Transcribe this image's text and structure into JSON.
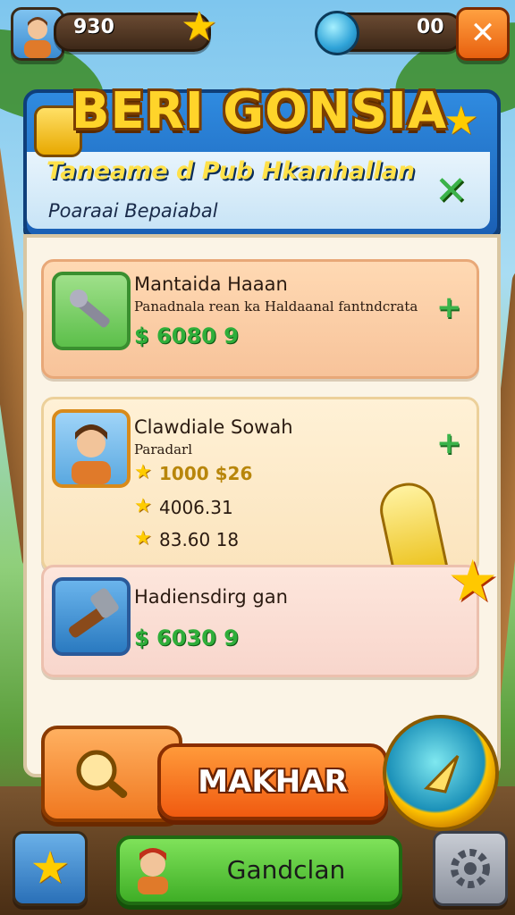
{
  "hud": {
    "coins_value": "930",
    "gems_value": "00",
    "close_glyph": "✕",
    "avatar_icon": "player-avatar-icon",
    "star_icon": "star-icon",
    "gem_icon": "gem-icon"
  },
  "header": {
    "title": "BERI GONSIA",
    "subtitle": "Taneame d Pub Hkanhallan",
    "caption": "Poaraai Bepaiabal",
    "close_glyph": "✕"
  },
  "items": [
    {
      "title": "Mantaida Haaan",
      "description": "Panadnala rean ka Haldaanal fantndcrata",
      "price": "$ 6080 9",
      "icon": "wrench-tool-icon"
    },
    {
      "title": "Clawdiale Sowah",
      "description": "Paradarl",
      "stats": [
        "1000 $26",
        "4006.31",
        "83.60 18"
      ],
      "icon": "character-portrait-icon"
    },
    {
      "title": "Hadiensdirg gan",
      "price": "$ 6030 9",
      "icon": "hammer-tool-icon"
    }
  ],
  "actions": {
    "primary_label": "MAKHAR",
    "secondary_label": "Gandclan"
  },
  "colors": {
    "accent_blue": "#1a5fb4",
    "title_gold": "#ffd42a",
    "price_green": "#2fae3a",
    "button_orange": "#f05a10",
    "button_green": "#3fae26"
  }
}
